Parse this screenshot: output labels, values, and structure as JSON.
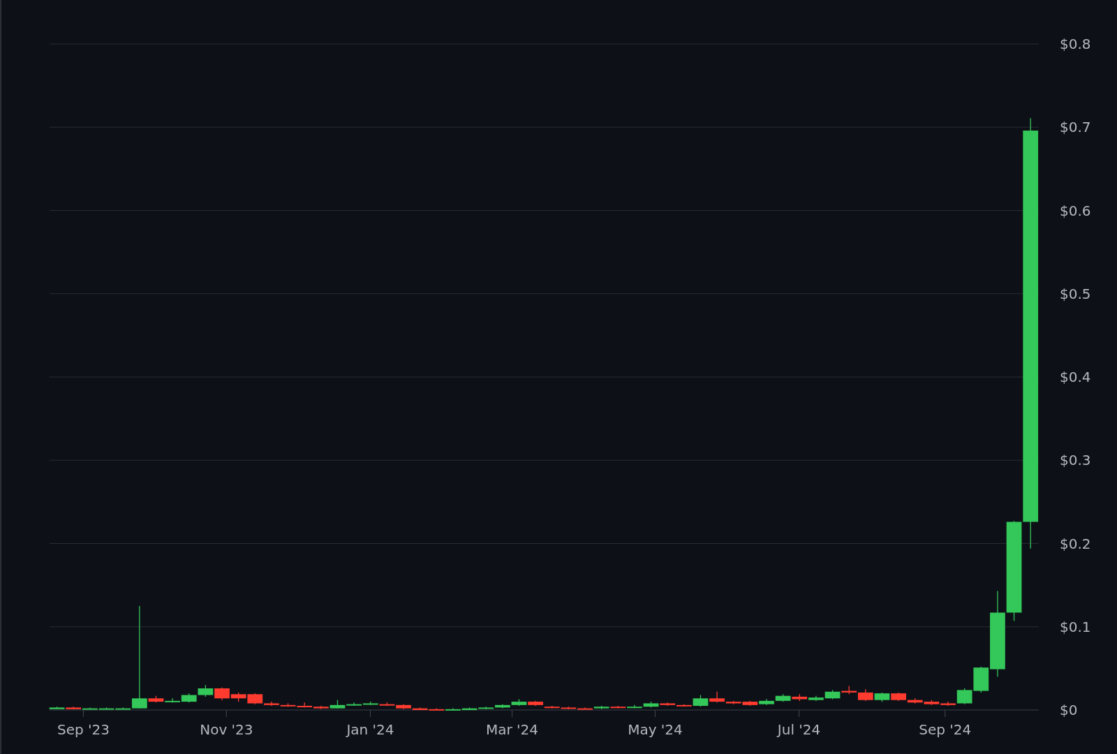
{
  "price_axis": {
    "labels": [
      "$0.8",
      "$0.7",
      "$0.6",
      "$0.5",
      "$0.4",
      "$0.3",
      "$0.2",
      "$0.1",
      "$0"
    ]
  },
  "date_axis": {
    "labels": [
      "Sep '23",
      "Nov '23",
      "Jan '24",
      "Mar '24",
      "May '24",
      "Jul '24",
      "Sep '24"
    ]
  }
}
